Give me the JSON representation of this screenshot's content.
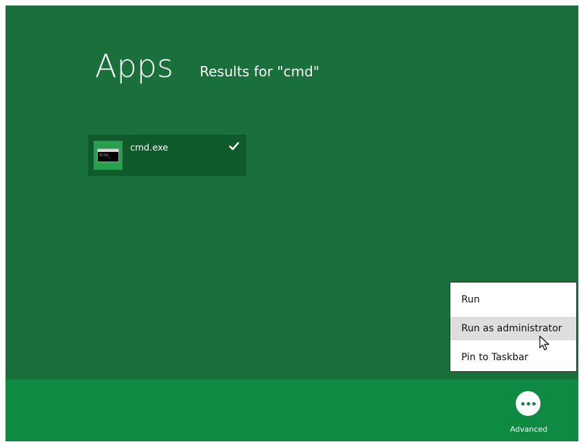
{
  "search": {
    "title": "Apps",
    "subtitle": "Results for \"cmd\""
  },
  "results": [
    {
      "label": "cmd.exe",
      "icon": "command-prompt-icon",
      "selected": true,
      "check_icon": "checkmark-icon"
    }
  ],
  "context_menu": {
    "items": [
      {
        "label": "Run",
        "highlighted": false
      },
      {
        "label": "Run as administrator",
        "highlighted": true
      },
      {
        "label": "Pin to Taskbar",
        "highlighted": false
      }
    ]
  },
  "app_bar": {
    "advanced": {
      "label": "Advanced",
      "icon": "more-dots-icon"
    }
  },
  "cmd_icon_text": "C:\\>_",
  "colors": {
    "background": "#19703a",
    "app_bar": "#0f8a43",
    "tile": "#0e5a2b",
    "tile_icon_bg": "#27a04d",
    "menu_highlight": "#dedede"
  }
}
